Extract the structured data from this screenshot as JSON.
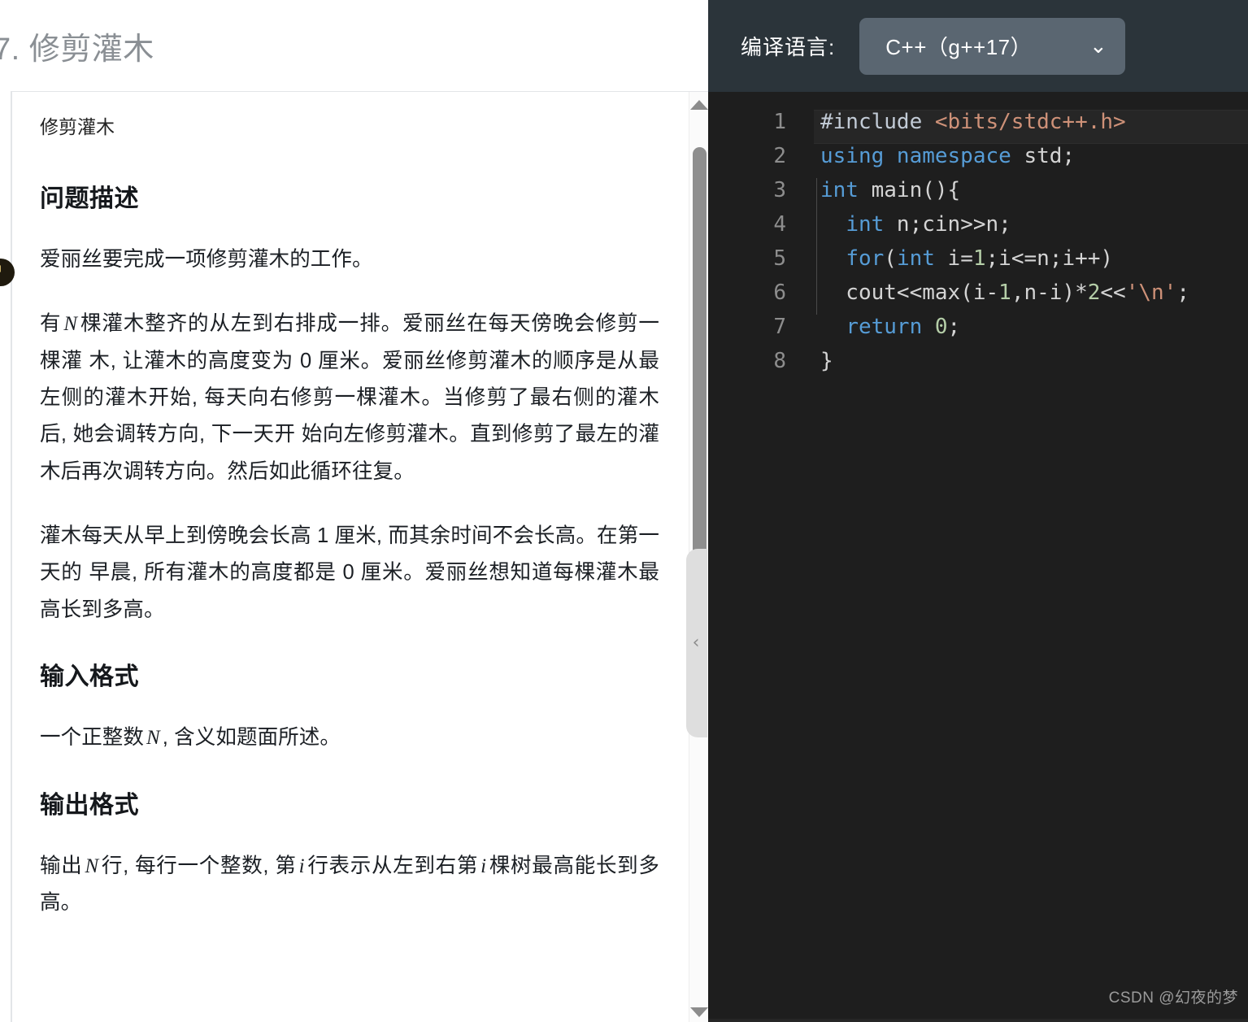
{
  "problem": {
    "title": "7. 修剪灌木",
    "lead": "修剪灌木",
    "sections": {
      "description_heading": "问题描述",
      "description_p1": "爱丽丝要完成一项修剪灌木的工作。",
      "description_p2_a": "有",
      "description_p2_var": "N",
      "description_p2_b": "棵灌木整齐的从左到右排成一排。爱丽丝在每天傍晚会修剪一棵灌 木, 让灌木的高度变为 0 厘米。爱丽丝修剪灌木的顺序是从最左侧的灌木开始, 每天向右修剪一棵灌木。当修剪了最右侧的灌木后, 她会调转方向, 下一天开 始向左修剪灌木。直到修剪了最左的灌木后再次调转方向。然后如此循环往复。",
      "description_p3": "灌木每天从早上到傍晚会长高 1 厘米, 而其余时间不会长高。在第一天的 早晨, 所有灌木的高度都是 0 厘米。爱丽丝想知道每棵灌木最高长到多高。",
      "input_heading": "输入格式",
      "input_p_a": "一个正整数",
      "input_p_var": "N",
      "input_p_b": ", 含义如题面所述。",
      "output_heading": "输出格式",
      "output_p_a": "输出",
      "output_p_var1": "N",
      "output_p_b": "行, 每行一个整数, 第",
      "output_p_var2": "i",
      "output_p_c": "行表示从左到右第",
      "output_p_var3": "i",
      "output_p_d": "棵树最高能长到多高。"
    }
  },
  "scrollbar": {
    "up_arrow": "scroll-up-arrow",
    "down_arrow": "scroll-down-arrow"
  },
  "collapse": {
    "chevron": "‹"
  },
  "editor": {
    "language_label": "编译语言:",
    "language_value": "C++（g++17）",
    "caret": "⌄",
    "lines": [
      {
        "n": "1",
        "active": true,
        "tokens": [
          {
            "t": "#include ",
            "c": "tk-pre"
          },
          {
            "t": "<bits/stdc++.h>",
            "c": "tk-inc"
          }
        ]
      },
      {
        "n": "2",
        "active": false,
        "tokens": [
          {
            "t": "using namespace ",
            "c": "tk-kw"
          },
          {
            "t": "std;",
            "c": "tk-plain"
          }
        ]
      },
      {
        "n": "3",
        "active": false,
        "tokens": [
          {
            "t": "int",
            "c": "tk-kw"
          },
          {
            "t": " main(){",
            "c": "tk-plain"
          }
        ]
      },
      {
        "n": "4",
        "active": false,
        "tokens": [
          {
            "t": "  ",
            "c": "tk-plain"
          },
          {
            "t": "int",
            "c": "tk-kw"
          },
          {
            "t": " n;cin>>n;",
            "c": "tk-plain"
          }
        ]
      },
      {
        "n": "5",
        "active": false,
        "tokens": [
          {
            "t": "  ",
            "c": "tk-plain"
          },
          {
            "t": "for",
            "c": "tk-kw"
          },
          {
            "t": "(",
            "c": "tk-plain"
          },
          {
            "t": "int",
            "c": "tk-kw"
          },
          {
            "t": " i=",
            "c": "tk-plain"
          },
          {
            "t": "1",
            "c": "tk-num"
          },
          {
            "t": ";i<=n;i++)",
            "c": "tk-plain"
          }
        ]
      },
      {
        "n": "6",
        "active": false,
        "tokens": [
          {
            "t": "  cout<<max(i-",
            "c": "tk-plain"
          },
          {
            "t": "1",
            "c": "tk-num"
          },
          {
            "t": ",n-i)*",
            "c": "tk-plain"
          },
          {
            "t": "2",
            "c": "tk-num"
          },
          {
            "t": "<<",
            "c": "tk-plain"
          },
          {
            "t": "'\\n'",
            "c": "tk-str"
          },
          {
            "t": ";",
            "c": "tk-plain"
          }
        ]
      },
      {
        "n": "7",
        "active": false,
        "tokens": [
          {
            "t": "  ",
            "c": "tk-plain"
          },
          {
            "t": "return",
            "c": "tk-kw"
          },
          {
            "t": " ",
            "c": "tk-plain"
          },
          {
            "t": "0",
            "c": "tk-num"
          },
          {
            "t": ";",
            "c": "tk-plain"
          }
        ]
      },
      {
        "n": "8",
        "active": false,
        "tokens": [
          {
            "t": "}",
            "c": "tk-plain"
          }
        ]
      }
    ],
    "watermark": "CSDN @幻夜的梦"
  },
  "colors": {
    "editor_header_bg": "#2b343a",
    "editor_bg": "#1e1e1e",
    "select_bg": "#5a6671",
    "keyword": "#569cd6",
    "string": "#ce9178",
    "number": "#b5cea8",
    "plain": "#d4d4d4"
  }
}
